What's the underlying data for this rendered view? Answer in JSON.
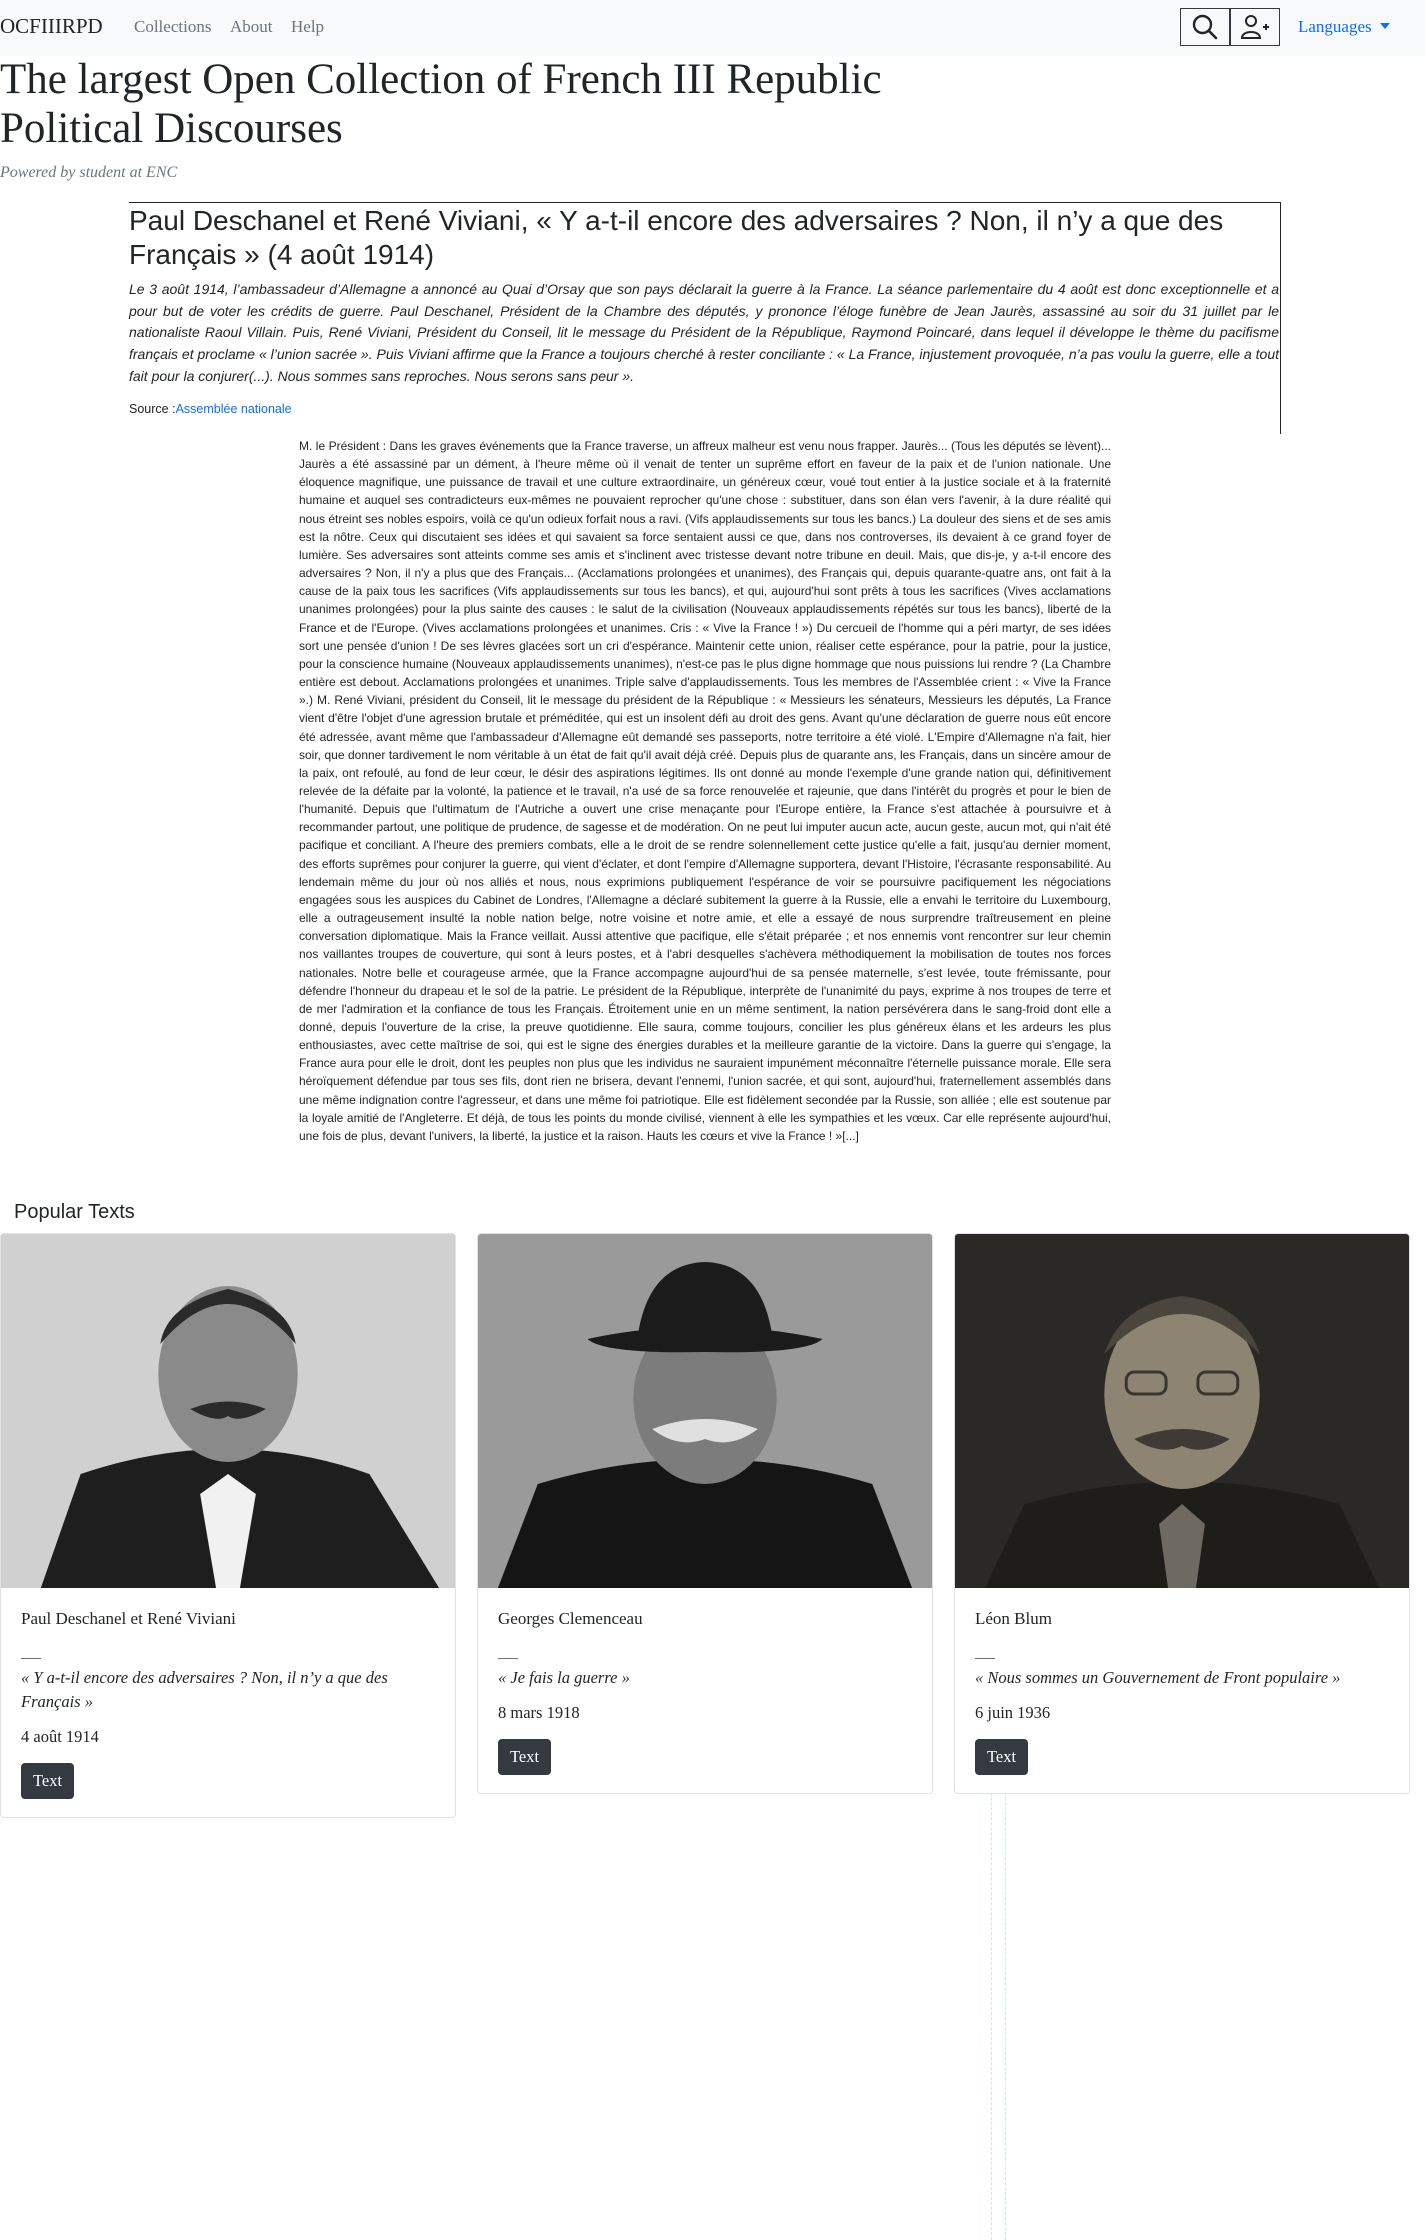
{
  "navbar": {
    "brand": "OCFIIIRPD",
    "links": [
      "Collections",
      "About",
      "Help"
    ],
    "languages_label": "Languages"
  },
  "hero": {
    "title": "The largest Open Collection of French III Republic Political Discourses",
    "subtitle": "Powered by student at ENC"
  },
  "document": {
    "title": "Paul Deschanel et René Viviani, « Y a-t-il encore des adversaires ? Non, il n’y a que des Français » (4 août 1914)",
    "intro": "Le 3 août 1914, l’ambassadeur d’Allemagne a annoncé au Quai d’Orsay que son pays déclarait la guerre à la France. La séance parlementaire du 4 août est donc exceptionnelle et a pour but de voter les crédits de guerre. Paul Deschanel, Président de la Chambre des députés, y prononce l’éloge funèbre de Jean Jaurès, assassiné au soir du 31 juillet par le nationaliste Raoul Villain. Puis, René Viviani, Président du Conseil, lit le message du Président de la République, Raymond Poincaré, dans lequel il développe le thème du pacifisme français et proclame « l’union sacrée ». Puis Viviani affirme que la France a toujours cherché à rester conciliante : « La France, injustement provoquée, n’a pas voulu la guerre, elle a tout fait pour la conjurer(...). Nous sommes sans reproches. Nous serons sans peur ».",
    "source_label": "Source :",
    "source_link": "Assemblée nationale",
    "speech": "M. le Président : Dans les graves événements que la France traverse, un affreux malheur est venu nous frapper. Jaurès... (Tous les députés se lèvent)... Jaurès a été assassiné par un dément, à l'heure même où il venait de tenter un suprême effort en faveur de la paix et de l'union nationale. Une éloquence magnifique, une puissance de travail et une culture extraordinaire, un généreux cœur, voué tout entier à la justice sociale et à la fraternité humaine et auquel ses contradicteurs eux-mêmes ne pouvaient reprocher qu'une chose : substituer, dans son élan vers l'avenir, à la dure réalité qui nous étreint ses nobles espoirs, voilà ce qu'un odieux forfait nous a ravi. (Vifs applaudissements sur tous les bancs.) La douleur des siens et de ses amis est la nôtre. Ceux qui discutaient ses idées et qui savaient sa force sentaient aussi ce que, dans nos controverses, ils devaient à ce grand foyer de lumière. Ses adversaires sont atteints comme ses amis et s'inclinent avec tristesse devant notre tribune en deuil. Mais, que dis-je, y a-t-il encore des adversaires ? Non, il n'y a plus que des Français... (Acclamations prolongées et unanimes), des Français qui, depuis quarante-quatre ans, ont fait à la cause de la paix tous les sacrifices (Vifs applaudissements sur tous les bancs), et qui, aujourd'hui sont prêts à tous les sacrifices (Vives acclamations unanimes prolongées) pour la plus sainte des causes : le salut de la civilisation (Nouveaux applaudissements répétés sur tous les bancs), liberté de la France et de l'Europe. (Vives acclamations prolongées et unanimes. Cris : « Vive la France ! ») Du cercueil de l'homme qui a péri martyr, de ses idées sort une pensée d'union ! De ses lèvres glacées sort un cri d'espérance. Maintenir cette union, réaliser cette espérance, pour la patrie, pour la justice, pour la conscience humaine (Nouveaux applaudissements unanimes), n'est-ce pas le plus digne hommage que nous puissions lui rendre ? (La Chambre entière est debout. Acclamations prolongées et unanimes. Triple salve d'applaudissements. Tous les membres de l'Assemblée crient : « Vive la France ».) M. René Viviani, président du Conseil, lit le message du président de la République : « Messieurs les sénateurs, Messieurs les députés, La France vient d'être l'objet d'une agression brutale et préméditée, qui est un insolent défi au droit des gens. Avant qu'une déclaration de guerre nous eût encore été adressée, avant même que l'ambassadeur d'Allemagne eût demandé ses passeports, notre territoire a été violé. L'Empire d'Allemagne n'a fait, hier soir, que donner tardivement le nom véritable à un état de fait qu'il avait déjà créé. Depuis plus de quarante ans, les Français, dans un sincère amour de la paix, ont refoulé, au fond de leur cœur, le désir des aspirations légitimes. Ils ont donné au monde l'exemple d'une grande nation qui, définitivement relevée de la défaite par la volonté, la patience et le travail, n'a usé de sa force renouvelée et rajeunie, que dans l'intérêt du progrès et pour le bien de l'humanité. Depuis que l'ultimatum de l'Autriche a ouvert une crise menaçante pour l'Europe entière, la France s'est attachée à poursuivre et à recommander partout, une politique de prudence, de sagesse et de modération. On ne peut lui imputer aucun acte, aucun geste, aucun mot, qui n'ait été pacifique et conciliant. A l'heure des premiers combats, elle a le droit de se rendre solennellement cette justice qu'elle a fait, jusqu'au dernier moment, des efforts suprêmes pour conjurer la guerre, qui vient d'éclater, et dont l'empire d'Allemagne supportera, devant l'Histoire, l'écrasante responsabilité. Au lendemain même du jour où nos alliés et nous, nous exprimions publiquement l'espérance de voir se poursuivre pacifiquement les négociations engagées sous les auspices du Cabinet de Londres, l'Allemagne a déclaré subitement la guerre à la Russie, elle a envahi le territoire du Luxembourg, elle a outrageusement insulté la noble nation belge, notre voisine et notre amie, et elle a essayé de nous surprendre traîtreusement en pleine conversation diplomatique. Mais la France veillait. Aussi attentive que pacifique, elle s'était préparée ; et nos ennemis vont rencontrer sur leur chemin nos vaillantes troupes de couverture, qui sont à leurs postes, et à l'abri desquelles s'achèvera méthodiquement la mobilisation de toutes nos forces nationales. Notre belle et courageuse armée, que la France accompagne aujourd'hui de sa pensée maternelle, s'est levée, toute frémissante, pour défendre l'honneur du drapeau et le sol de la patrie. Le président de la République, interprète de l'unanimité du pays, exprime à nos troupes de terre et de mer l'admiration et la confiance de tous les Français. Étroitement unie en un même sentiment, la nation persévérera dans le sang-froid dont elle a donné, depuis l'ouverture de la crise, la preuve quotidienne. Elle saura, comme toujours, concilier les plus généreux élans et les ardeurs les plus enthousiastes, avec cette maîtrise de soi, qui est le signe des énergies durables et la meilleure garantie de la victoire. Dans la guerre qui s'engage, la France aura pour elle le droit, dont les peuples non plus que les individus ne sauraient impunément méconnaître l'éternelle puissance morale. Elle sera héroïquement défendue par tous ses fils, dont rien ne brisera, devant l'ennemi, l'union sacrée, et qui sont, aujourd'hui, fraternellement assemblés dans une même indignation contre l'agresseur, et dans une même foi patriotique. Elle est fidèlement secondée par la Russie, son alliée ; elle est soutenue par la loyale amitié de l'Angleterre. Et déjà, de tous les points du monde civilisé, viennent à elle les sympathies et les vœux. Car elle représente aujourd'hui, une fois de plus, devant l'univers, la liberté, la justice et la raison. Hauts les cœurs et vive la France ! »[...]"
  },
  "popular": {
    "title": "Popular Texts",
    "cards": [
      {
        "author": "Paul Deschanel et René Viviani",
        "quote": "« Y a-t-il encore des adversaires ? Non, il n’y a que des Français »",
        "date": "4 août 1914",
        "button": "Text"
      },
      {
        "author": "Georges Clemenceau",
        "quote": "« Je fais la guerre »",
        "date": "8 mars 1918",
        "button": "Text"
      },
      {
        "author": "Léon Blum",
        "quote": "« Nous sommes un Gouvernement de Front populaire »",
        "date": "6 juin 1936",
        "button": "Text"
      }
    ]
  },
  "icons": {
    "search": "search-icon",
    "user_add": "user-add-icon",
    "caret": "caret-down-icon"
  },
  "colors": {
    "navbar_bg": "#f8f9fa",
    "link": "#0d6efd",
    "button_dark": "#343a40",
    "muted": "#6c757d"
  }
}
